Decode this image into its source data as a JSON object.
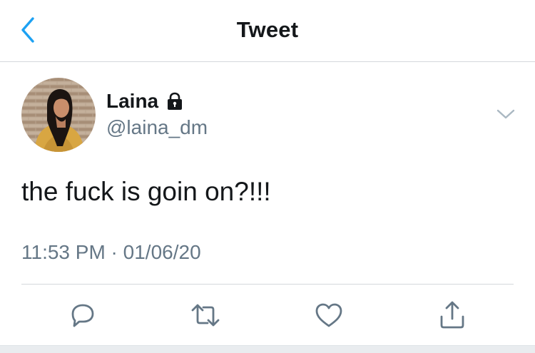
{
  "nav": {
    "title": "Tweet",
    "back_icon": "chevron-left-icon"
  },
  "author": {
    "display_name": "Laina",
    "handle": "@laina_dm",
    "protected_icon": "lock-icon",
    "avatar": "profile-photo"
  },
  "tweet": {
    "text": "the fuck is goin on?!!!",
    "timestamp": "11:53 PM · 01/06/20"
  },
  "actions": [
    "reply-icon",
    "retweet-icon",
    "like-icon",
    "share-icon"
  ],
  "colors": {
    "accent": "#1da1f2",
    "text": "#14171a",
    "secondary": "#657786",
    "border": "#d4d8dc"
  }
}
